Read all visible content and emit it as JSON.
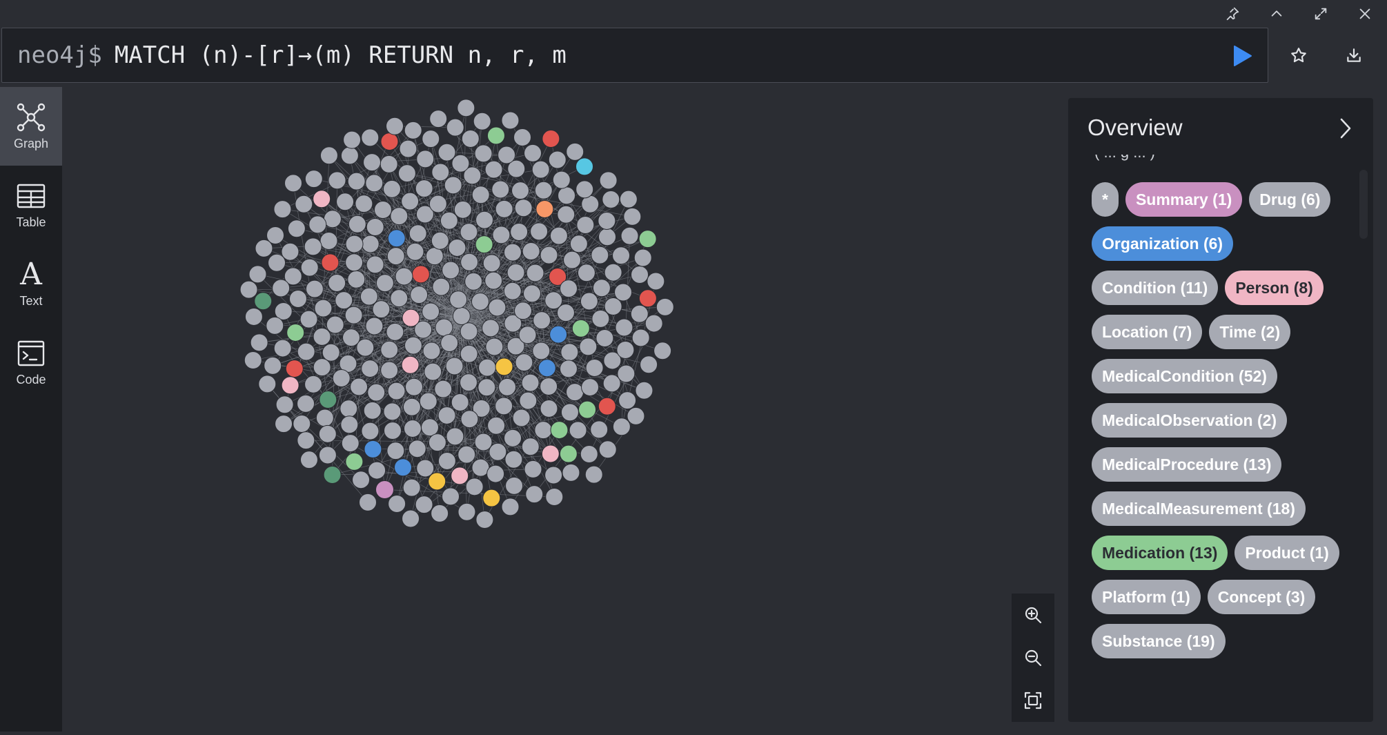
{
  "editor": {
    "prompt": "neo4j$",
    "query": "MATCH (n)-[r]→(m) RETURN n, r, m"
  },
  "sidebar": {
    "items": [
      {
        "label": "Graph",
        "icon": "graph-icon",
        "active": true
      },
      {
        "label": "Table",
        "icon": "table-icon",
        "active": false
      },
      {
        "label": "Text",
        "icon": "text-icon",
        "active": false
      },
      {
        "label": "Code",
        "icon": "code-icon",
        "active": false
      }
    ]
  },
  "overview": {
    "title": "Overview",
    "partial_text": "( ... g ... )",
    "labels": [
      {
        "text": "*",
        "color": "#a7aab3",
        "text_color": "#ffffff"
      },
      {
        "text": "Summary (1)",
        "color": "#c990c0",
        "text_color": "#ffffff"
      },
      {
        "text": "Drug (6)",
        "color": "#a7aab3",
        "text_color": "#ffffff"
      },
      {
        "text": "Organization (6)",
        "color": "#4c8eda",
        "text_color": "#ffffff"
      },
      {
        "text": "Condition (11)",
        "color": "#a7aab3",
        "text_color": "#ffffff"
      },
      {
        "text": "Person (8)",
        "color": "#f0b6c4",
        "text_color": "#2b2d33"
      },
      {
        "text": "Location (7)",
        "color": "#a7aab3",
        "text_color": "#ffffff"
      },
      {
        "text": "Time (2)",
        "color": "#a7aab3",
        "text_color": "#ffffff"
      },
      {
        "text": "MedicalCondition (52)",
        "color": "#a7aab3",
        "text_color": "#ffffff"
      },
      {
        "text": "MedicalObservation (2)",
        "color": "#a7aab3",
        "text_color": "#ffffff"
      },
      {
        "text": "MedicalProcedure (13)",
        "color": "#a7aab3",
        "text_color": "#ffffff"
      },
      {
        "text": "MedicalMeasurement (18)",
        "color": "#a7aab3",
        "text_color": "#ffffff"
      },
      {
        "text": "Medication (13)",
        "color": "#8dcc93",
        "text_color": "#2b2d33"
      },
      {
        "text": "Product (1)",
        "color": "#a7aab3",
        "text_color": "#ffffff"
      },
      {
        "text": "Platform (1)",
        "color": "#a7aab3",
        "text_color": "#ffffff"
      },
      {
        "text": "Concept (3)",
        "color": "#a7aab3",
        "text_color": "#ffffff"
      },
      {
        "text": "Substance (19)",
        "color": "#a7aab3",
        "text_color": "#ffffff"
      }
    ]
  },
  "graph": {
    "node_palette": {
      "default": "#a7aab3",
      "medication": "#8dcc93",
      "person": "#f0b6c4",
      "organization": "#4c8eda",
      "summary": "#c990c0",
      "red": "#e2554f",
      "yellow": "#f5c443",
      "teal": "#5a9a78",
      "orange": "#f79767",
      "cyan": "#57c7e3"
    },
    "edge_color": "#8b8e96"
  },
  "icons": {
    "pin": "pin-icon",
    "collapse_up": "chevron-up-icon",
    "expand": "expand-icon",
    "close": "close-icon",
    "run": "play-icon",
    "favorite": "star-icon",
    "download": "download-icon",
    "zoom_in": "zoom-in-icon",
    "zoom_out": "zoom-out-icon",
    "fit": "fit-to-screen-icon",
    "panel_collapse": "chevron-right-icon"
  }
}
